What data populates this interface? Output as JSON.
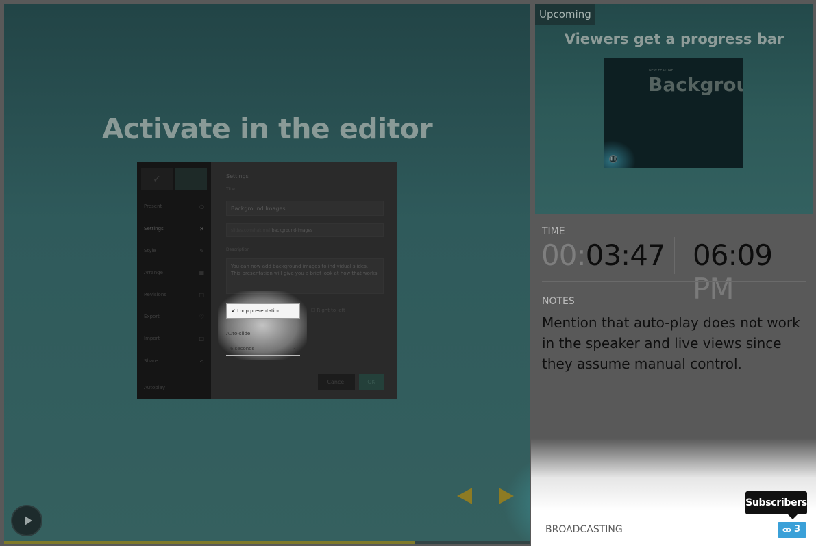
{
  "current_slide": {
    "title": "Activate in the editor",
    "editor": {
      "sidebar_items": [
        {
          "label": "Present",
          "icon": "circle-icon"
        },
        {
          "label": "Settings",
          "icon": "close-icon"
        },
        {
          "label": "Style",
          "icon": "pencil-icon"
        },
        {
          "label": "Arrange",
          "icon": "grid-icon"
        },
        {
          "label": "Revisions",
          "icon": "square-icon"
        },
        {
          "label": "Export",
          "icon": "heart-icon"
        },
        {
          "label": "Import",
          "icon": "square-icon"
        },
        {
          "label": "Share",
          "icon": "share-icon"
        },
        {
          "label": "Autoplay",
          "icon": ""
        }
      ],
      "settings_heading": "Settings",
      "title_label": "Title",
      "title_value": "Background Images",
      "url_prefix": "slides.com/hakimel/",
      "url_slug": "background-images",
      "description_label": "Description",
      "description_text": "You can now add background images to individual slides. This presentation will give you a brief look at how that works.",
      "loop_label": "Loop presentation",
      "right_option_label": "Right to left",
      "auto_slide_label": "Auto-slide",
      "auto_slide_value": "6 seconds",
      "cancel_label": "Cancel",
      "ok_label": "OK"
    }
  },
  "progress": {
    "fraction": 0.78
  },
  "upcoming": {
    "badge": "Upcoming",
    "title": "Viewers get a progress bar",
    "preview_kicker": "NEW FEATURE",
    "preview_title": "Backgrounds"
  },
  "time": {
    "label": "TIME",
    "elapsed_dim": "00:",
    "elapsed_main": "03:47",
    "clock_main": "06:09",
    "clock_period": "PM"
  },
  "notes": {
    "label": "NOTES",
    "text": "Mention that auto-play does not work in the speaker and live views since they assume manual control."
  },
  "footer": {
    "status": "BROADCASTING",
    "subscriber_count": "3",
    "tooltip": "Subscribers"
  },
  "colors": {
    "accent": "#3aa0d8",
    "slide_bg": "#2f5a5b",
    "nav_arrows": "#8d7b23"
  }
}
